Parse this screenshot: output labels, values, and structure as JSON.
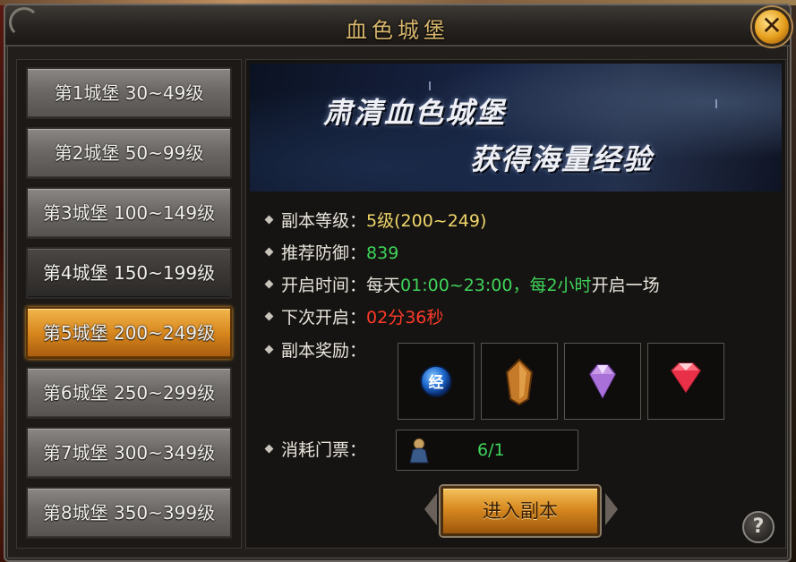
{
  "window": {
    "title": "血色城堡",
    "close_glyph": "✕"
  },
  "sidebar": {
    "items": [
      {
        "label": "第1城堡 30~49级",
        "state": "normal"
      },
      {
        "label": "第2城堡 50~99级",
        "state": "normal"
      },
      {
        "label": "第3城堡 100~149级",
        "state": "normal"
      },
      {
        "label": "第4城堡 150~199级",
        "state": "dark"
      },
      {
        "label": "第5城堡 200~249级",
        "state": "selected"
      },
      {
        "label": "第6城堡 250~299级",
        "state": "normal"
      },
      {
        "label": "第7城堡 300~349级",
        "state": "normal"
      },
      {
        "label": "第8城堡 350~399级",
        "state": "normal"
      }
    ]
  },
  "banner": {
    "line1": "肃清血色城堡",
    "line2": "获得海量经验"
  },
  "info": {
    "level_label": "副本等级：",
    "level_value": "5级(200~249)",
    "defense_label": "推荐防御：",
    "defense_value": "839",
    "open_label": "开启时间：",
    "open_p1": "每天",
    "open_p2": "01:00~23:00，",
    "open_p3": "每2小时",
    "open_p4": "开启一场",
    "next_label": "下次开启：",
    "next_value": "02分36秒",
    "reward_label": "副本奖励：",
    "ticket_label": "消耗门票：",
    "ticket_count": "6/1"
  },
  "rewards": [
    {
      "icon": "exp-orb-icon",
      "glyph": "经"
    },
    {
      "icon": "amber-crystal-icon"
    },
    {
      "icon": "purple-gem-icon"
    },
    {
      "icon": "red-gem-icon"
    }
  ],
  "actions": {
    "enter_label": "进入副本",
    "help_glyph": "?"
  },
  "colors": {
    "accent_gold": "#d6b56c",
    "green": "#3fd45a",
    "yellow": "#f0d66a",
    "red": "#ff3a2a"
  }
}
